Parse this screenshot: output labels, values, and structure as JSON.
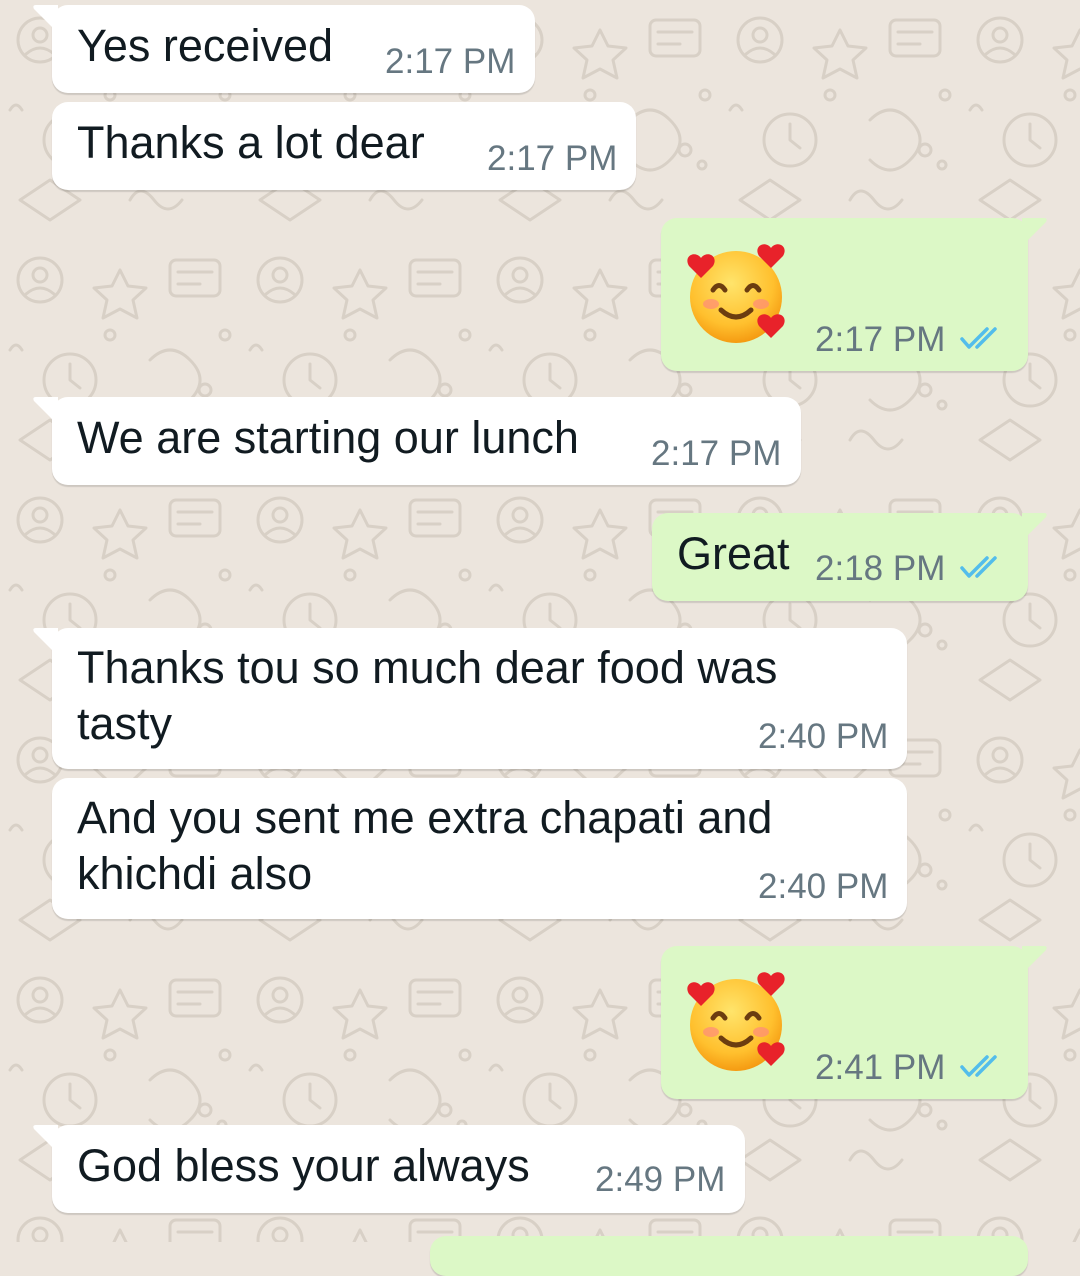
{
  "chat": {
    "messages": [
      {
        "direction": "incoming",
        "text": "Yes received",
        "time": "2:17 PM"
      },
      {
        "direction": "incoming",
        "text": "Thanks a lot dear",
        "time": "2:17 PM"
      },
      {
        "direction": "outgoing",
        "emoji": "smiling-face-with-hearts",
        "time": "2:17 PM",
        "status": "read"
      },
      {
        "direction": "incoming",
        "text": "We are starting our lunch",
        "time": "2:17 PM"
      },
      {
        "direction": "outgoing",
        "text": "Great",
        "time": "2:18 PM",
        "status": "read"
      },
      {
        "direction": "incoming",
        "text_lines": [
          "Thanks tou so much dear food was",
          "tasty"
        ],
        "time": "2:40 PM"
      },
      {
        "direction": "incoming",
        "text_lines": [
          "And you sent me extra chapati and",
          "khichdi also"
        ],
        "time": "2:40 PM"
      },
      {
        "direction": "outgoing",
        "emoji": "smiling-face-with-hearts",
        "time": "2:41 PM",
        "status": "read"
      },
      {
        "direction": "incoming",
        "text": "God bless your always",
        "time": "2:49 PM"
      }
    ]
  },
  "colors": {
    "wallpaper": "#ece5dd",
    "incoming_bubble": "#ffffff",
    "outgoing_bubble": "#dcf8c6",
    "read_ticks": "#53bdeb",
    "timestamp": "#667781"
  },
  "icons": {
    "read_receipt": "double-check-icon",
    "emoji": "smiling-face-with-hearts-emoji"
  }
}
